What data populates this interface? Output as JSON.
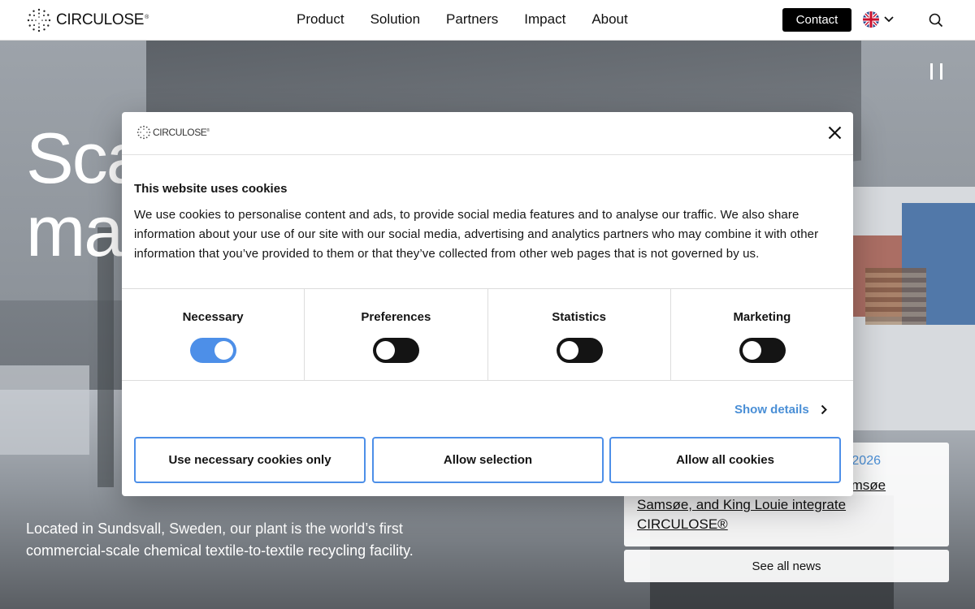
{
  "header": {
    "logo_text": "CIRCULOSE",
    "logo_mark": "®",
    "nav": [
      "Product",
      "Solution",
      "Partners",
      "Impact",
      "About"
    ],
    "contact_label": "Contact",
    "language_icon": "uk-flag-icon",
    "search_icon": "search-icon"
  },
  "hero": {
    "title_line1": "Sca",
    "title_line2": "ma",
    "description": "Located in Sundsvall, Sweden, our plant is the world’s first commercial-scale chemical textile-to-textile recycling facility.",
    "news_date": "2026",
    "news_title": "s EILEEN FISHER, Marimekko, Samsøe Samsøe, and King Louie integrate CIRCULOSE®",
    "see_all_label": "See all news"
  },
  "cookie_dialog": {
    "logo_text": "CIRCULOSE",
    "logo_mark": "®",
    "title": "This website uses cookies",
    "body": "We use cookies to personalise content and ads, to provide social media features and to analyse our traffic. We also share information about your use of our site with our social media, advertising and analytics partners who may combine it with other information that you’ve provided to them or that they’ve collected from other web pages that is not governed by us.",
    "categories": [
      {
        "label": "Necessary",
        "enabled": true
      },
      {
        "label": "Preferences",
        "enabled": false
      },
      {
        "label": "Statistics",
        "enabled": false
      },
      {
        "label": "Marketing",
        "enabled": false
      }
    ],
    "show_details_label": "Show details",
    "buttons": {
      "necessary_only": "Use necessary cookies only",
      "allow_selection": "Allow selection",
      "allow_all": "Allow all cookies"
    }
  },
  "colors": {
    "accent_blue": "#4d8fe8",
    "link_blue": "#4a8fd6",
    "toggle_off": "#141414"
  }
}
